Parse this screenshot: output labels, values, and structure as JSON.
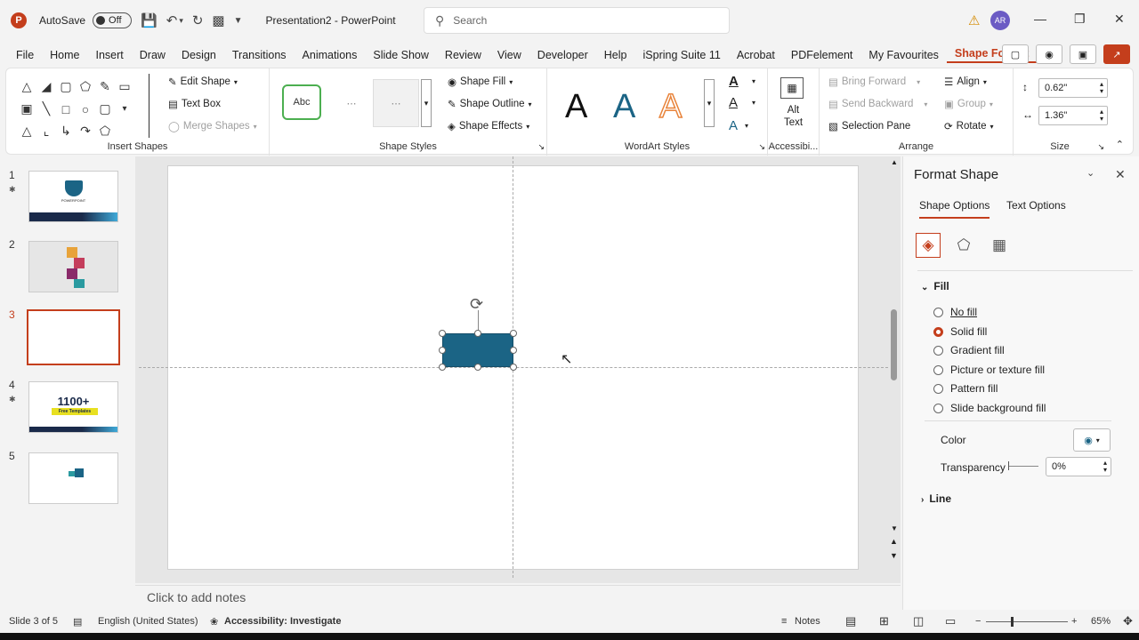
{
  "title_bar": {
    "app_logo": "P",
    "autosave_label": "AutoSave",
    "autosave_state": "Off",
    "doc_title": "Presentation2 - PowerPoint",
    "search_placeholder": "Search",
    "avatar_initials": "AR",
    "icons": [
      "save-icon",
      "undo-icon",
      "redo-icon",
      "present-icon",
      "customize-icon",
      "warning-icon",
      "minimize-icon",
      "restore-icon",
      "close-icon"
    ]
  },
  "menu": {
    "items": [
      "File",
      "Home",
      "Insert",
      "Draw",
      "Design",
      "Transitions",
      "Animations",
      "Slide Show",
      "Review",
      "View",
      "Developer",
      "Help",
      "iSpring Suite 11",
      "Acrobat",
      "PDFelement",
      "My Favourites",
      "Shape Format"
    ],
    "active": "Shape Format"
  },
  "ribbon": {
    "insert_shapes": {
      "label": "Insert Shapes",
      "edit_shape": "Edit Shape",
      "text_box": "Text Box",
      "merge_shapes": "Merge Shapes"
    },
    "shape_styles": {
      "label": "Shape Styles",
      "preset_text": "Abc",
      "shape_fill": "Shape Fill",
      "shape_outline": "Shape Outline",
      "shape_effects": "Shape Effects"
    },
    "wordart": {
      "label": "WordArt Styles",
      "letter": "A",
      "colors": [
        "#111111",
        "#1b6485",
        "#e8833a"
      ]
    },
    "accessibility": {
      "label": "Accessibi...",
      "alt_text_line1": "Alt",
      "alt_text_line2": "Text"
    },
    "arrange": {
      "label": "Arrange",
      "bring_forward": "Bring Forward",
      "send_backward": "Send Backward",
      "selection_pane": "Selection Pane",
      "align": "Align",
      "group": "Group",
      "rotate": "Rotate"
    },
    "size": {
      "label": "Size",
      "height": "0.62\"",
      "width": "1.36\""
    }
  },
  "slides": [
    {
      "number": "1",
      "starred": true,
      "content": "POWERPOINT"
    },
    {
      "number": "2",
      "starred": false,
      "content": ""
    },
    {
      "number": "3",
      "starred": false,
      "content": ""
    },
    {
      "number": "4",
      "starred": true,
      "content_line1": "1100+",
      "content_line2": "Free Templates"
    },
    {
      "number": "5",
      "starred": false,
      "content": ""
    }
  ],
  "active_slide": "3",
  "selected_shape": {
    "fill": "#1b6485"
  },
  "notes_placeholder": "Click to add notes",
  "format_pane": {
    "title": "Format Shape",
    "tabs": [
      "Shape Options",
      "Text Options"
    ],
    "active_tab": "Shape Options",
    "fill_section": "Fill",
    "fill_options": [
      "No fill",
      "Solid fill",
      "Gradient fill",
      "Picture or texture fill",
      "Pattern fill",
      "Slide background fill"
    ],
    "selected_fill": "Solid fill",
    "color_label": "Color",
    "transparency_label": "Transparency",
    "transparency_value": "0%",
    "line_section": "Line"
  },
  "status": {
    "slide_info": "Slide 3 of 5",
    "language": "English (United States)",
    "accessibility": "Accessibility: Investigate",
    "notes": "Notes",
    "zoom": "65%"
  },
  "colors": {
    "accent": "#c43e1c",
    "shape_fill": "#1b6485"
  }
}
